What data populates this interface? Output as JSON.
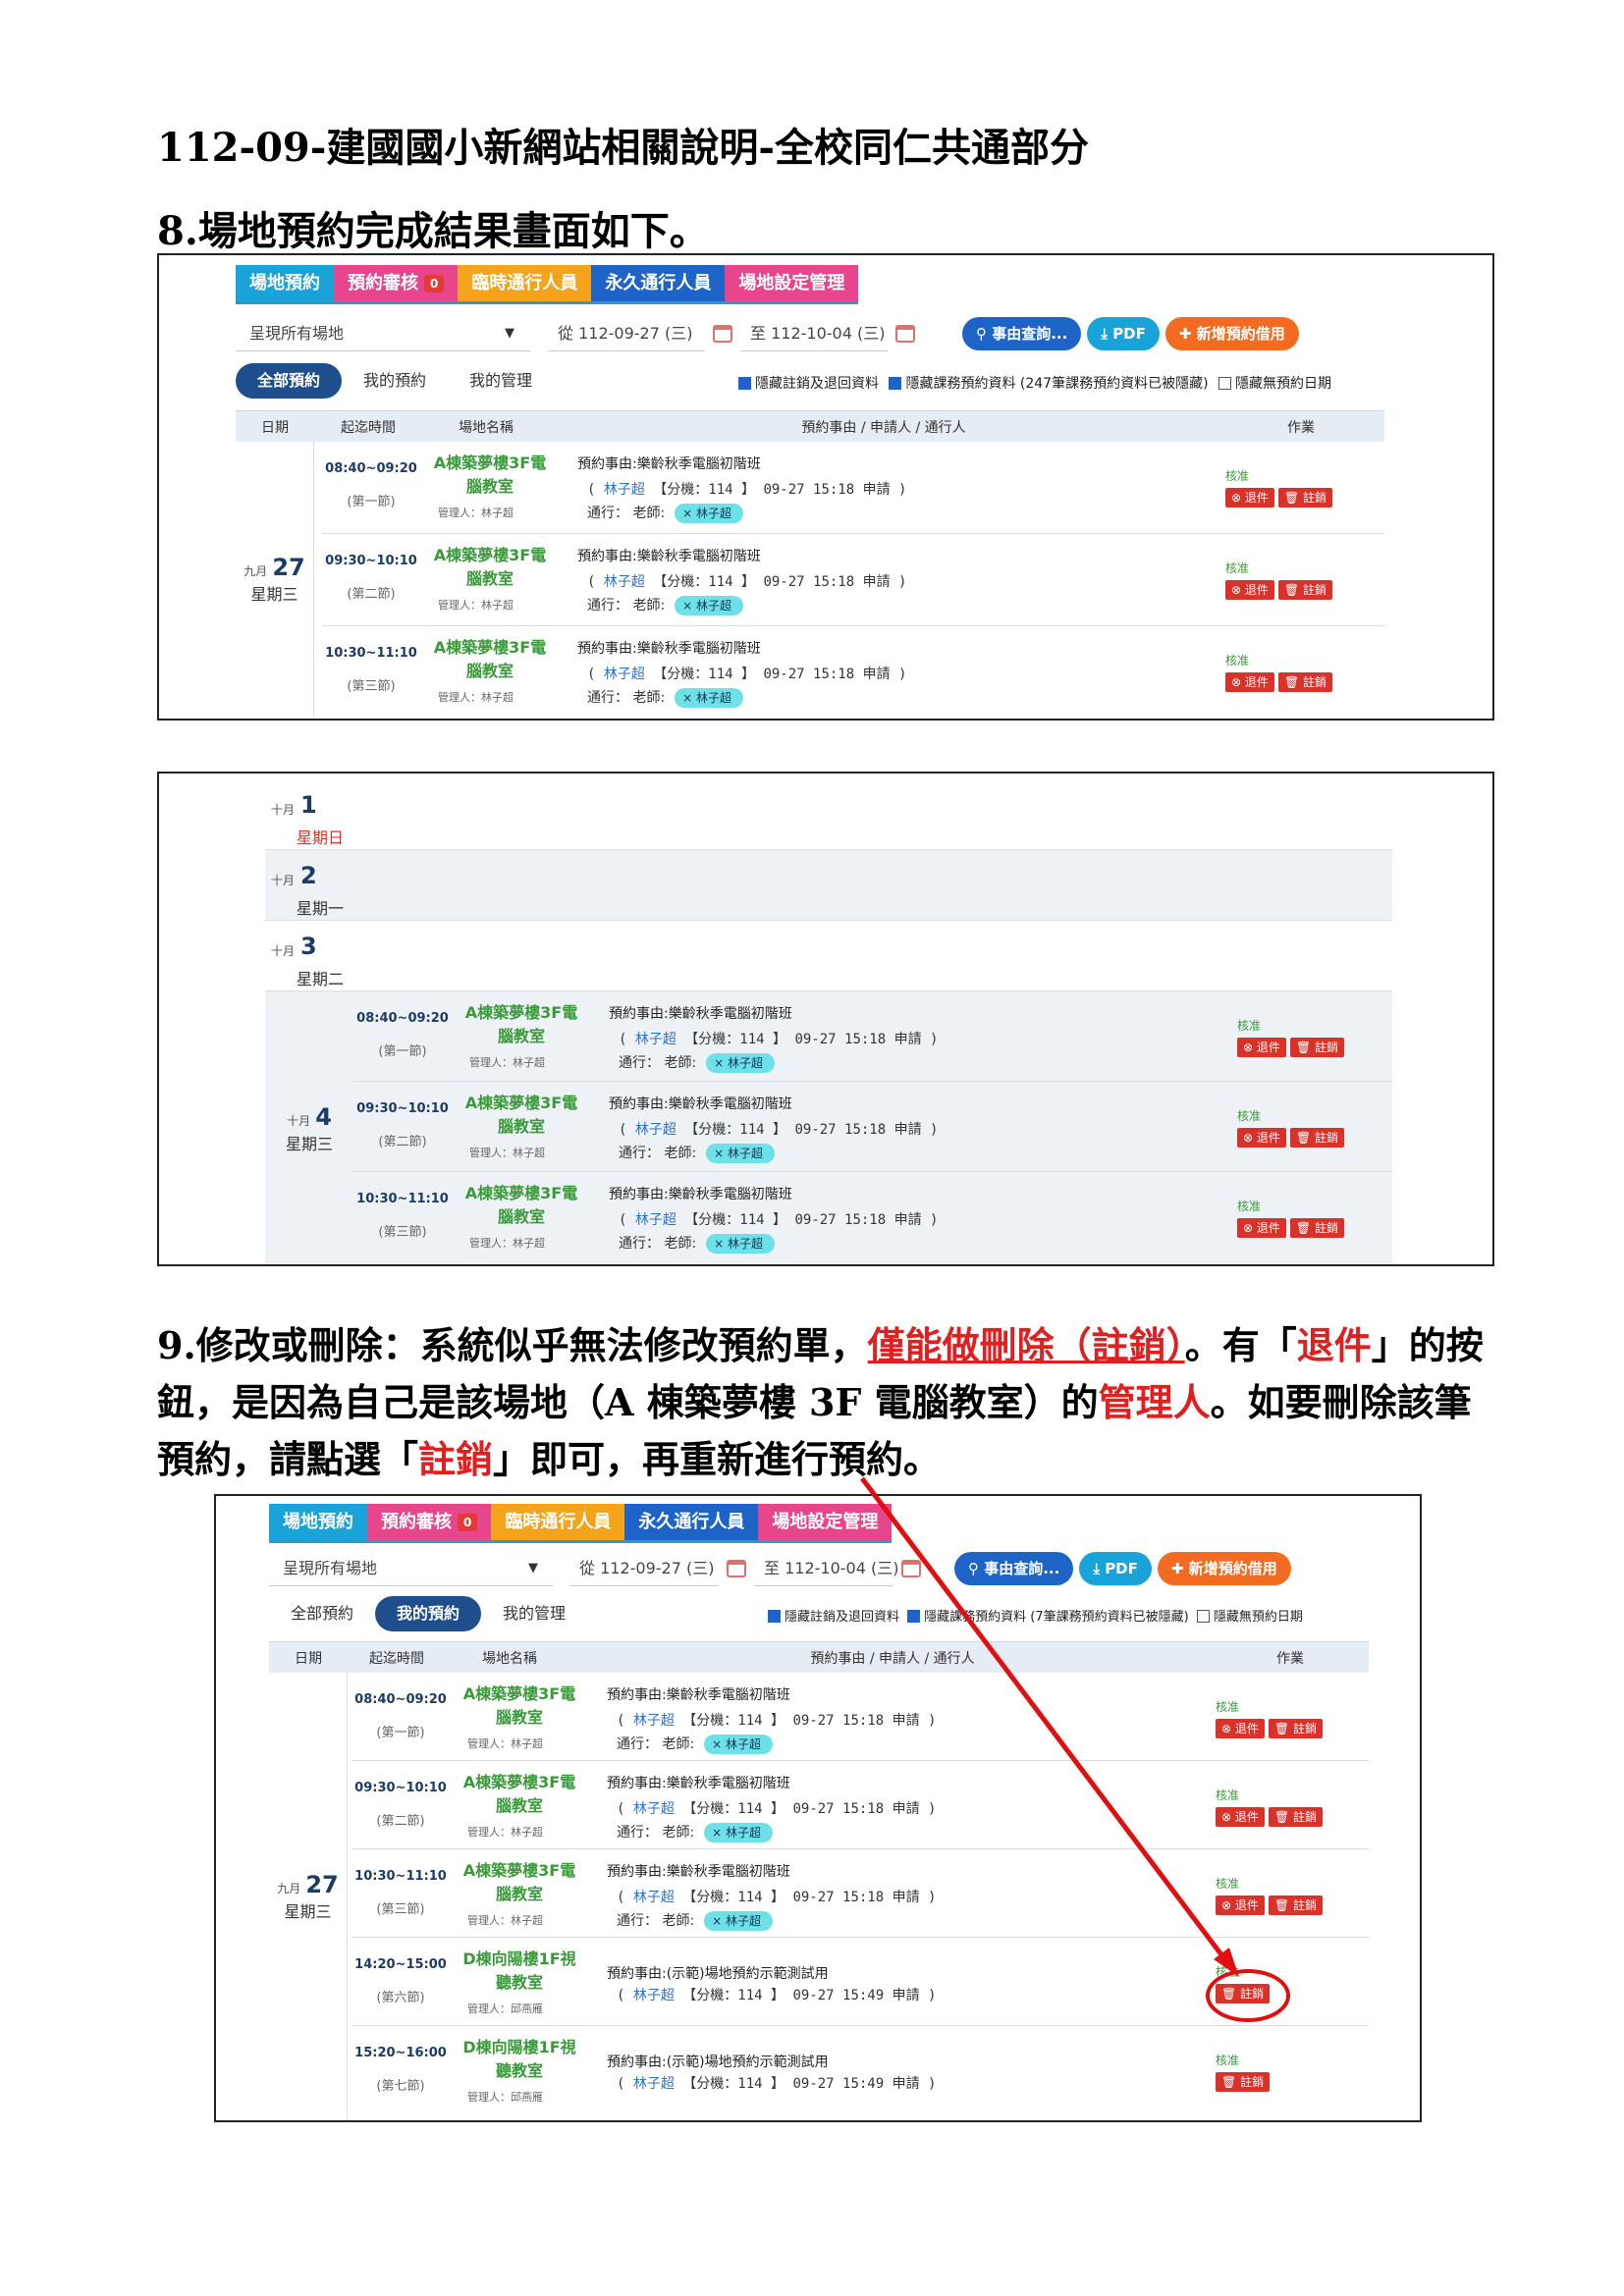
{
  "doc": {
    "title": "112-09-建國國小新網站相關說明-全校同仁共通部分",
    "section8": "8.場地預約完成結果畫面如下。",
    "section9": {
      "p1": "9.修改或刪除：系統似乎無法修改預約單，",
      "p2": "僅能做刪除（註銷）",
      "p3": "。有「",
      "p4": "退件",
      "p5": "」的按鈕，是因為自己是該場地（A 棟築夢樓 3F 電腦教室）的",
      "p6": "管理人",
      "p7": "。如要刪除該筆預約，請點選「",
      "p8": "註銷",
      "p9": "」即可，再重新進行預約。"
    }
  },
  "ui": {
    "tabs": [
      "場地預約",
      "預約審核",
      "臨時通行人員",
      "永久通行人員",
      "場地設定管理"
    ],
    "pending_count": "0",
    "tab_colors": [
      "#1aa3d8",
      "#e8468c",
      "#f3a31c",
      "#1e64c8",
      "#e8468c"
    ],
    "venue_select": "呈現所有場地",
    "date_from_prefix": "從",
    "date_from": "112-09-27 (三)",
    "date_to_prefix": "至",
    "date_to": "112-10-04 (三)",
    "btn_search": "事由查詢...",
    "btn_pdf": "PDF",
    "btn_add": "新增預約借用",
    "subtabs": [
      "全部預約",
      "我的預約",
      "我的管理"
    ],
    "chk_hide_cancel": "隱藏註銷及退回資料",
    "chk_hide_course_a": "隱藏課務預約資料 (247筆課務預約資料已被隱藏)",
    "chk_hide_course_b": "隱藏課務預約資料 (7筆課務預約資料已被隱藏)",
    "chk_hide_empty": "隱藏無預約日期",
    "headers": [
      "日期",
      "起迄時間",
      "場地名稱",
      "預約事由 / 申請人 / 通行人",
      "作業"
    ],
    "approved": "核准",
    "btn_reject": "退件",
    "btn_cancel": "註銷",
    "pass_label": "通行：",
    "teacher_label": "老師:"
  },
  "days": {
    "sep27": {
      "month": "九月",
      "day": "27",
      "weekday": "星期三"
    },
    "oct1": {
      "month": "十月",
      "day": "1",
      "weekday": "星期日"
    },
    "oct2": {
      "month": "十月",
      "day": "2",
      "weekday": "星期一"
    },
    "oct3": {
      "month": "十月",
      "day": "3",
      "weekday": "星期二"
    },
    "oct4": {
      "month": "十月",
      "day": "4",
      "weekday": "星期三"
    }
  },
  "bookings": {
    "b1": {
      "time": "08:40~09:20",
      "period": "(第一節)"
    },
    "b2": {
      "time": "09:30~10:10",
      "period": "(第二節)"
    },
    "b3": {
      "time": "10:30~11:10",
      "period": "(第三節)"
    },
    "b6": {
      "time": "14:20~15:00",
      "period": "(第六節)"
    },
    "b7": {
      "time": "15:20~16:00",
      "period": "(第七節)"
    },
    "venueA1": "A棟築夢樓3F電",
    "venueA2": "腦教室",
    "venueD1": "D棟向陽樓1F視",
    "venueD2": "聽教室",
    "mgrA": "管理人：林子超",
    "mgrD": "管理人：邱燕雁",
    "reasonA": "預約事由:樂齡秋季電腦初階班",
    "reasonD": "預約事由:(示範)場地預約示範測試用",
    "applicant_name": "林子超",
    "applicant_restA": "【分機：114 】 09-27 15:18 申請 )",
    "applicant_restD": "【分機：114 】 09-27 15:49 申請 )",
    "teacher": "林子超"
  }
}
